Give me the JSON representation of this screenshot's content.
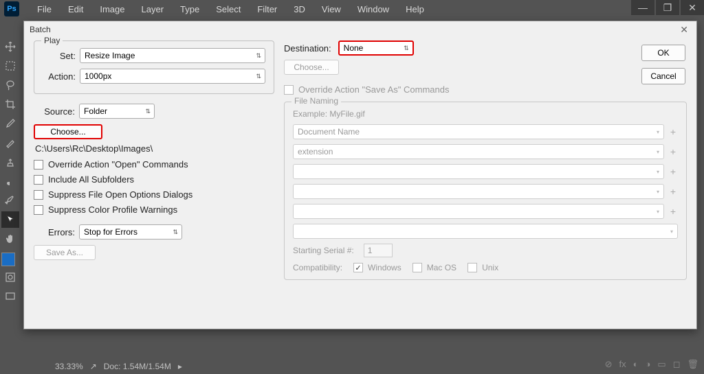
{
  "app": {
    "logo": "Ps"
  },
  "menu": [
    "File",
    "Edit",
    "Image",
    "Layer",
    "Type",
    "Select",
    "Filter",
    "3D",
    "View",
    "Window",
    "Help"
  ],
  "dialog": {
    "title": "Batch",
    "play": {
      "legend": "Play",
      "set_label": "Set:",
      "set_value": "Resize Image",
      "action_label": "Action:",
      "action_value": "1000px"
    },
    "source": {
      "label": "Source:",
      "value": "Folder",
      "choose": "Choose...",
      "path": "C:\\Users\\Rc\\Desktop\\Images\\",
      "override_open": "Override Action \"Open\" Commands",
      "include_subfolders": "Include All Subfolders",
      "suppress_dialogs": "Suppress File Open Options Dialogs",
      "suppress_color": "Suppress Color Profile Warnings"
    },
    "errors": {
      "label": "Errors:",
      "value": "Stop for Errors",
      "save_as": "Save As..."
    },
    "destination": {
      "label": "Destination:",
      "value": "None",
      "choose": "Choose...",
      "override_save": "Override Action \"Save As\" Commands"
    },
    "naming": {
      "legend": "File Naming",
      "example_label": "Example:",
      "example_value": "MyFile.gif",
      "fields": [
        "Document Name",
        "extension",
        "",
        "",
        "",
        ""
      ],
      "serial_label": "Starting Serial #:",
      "serial_value": "1",
      "compat_label": "Compatibility:",
      "compat_windows": "Windows",
      "compat_mac": "Mac OS",
      "compat_unix": "Unix"
    },
    "ok": "OK",
    "cancel": "Cancel"
  },
  "status": {
    "zoom": "33.33%",
    "doc": "Doc: 1.54M/1.54M"
  }
}
